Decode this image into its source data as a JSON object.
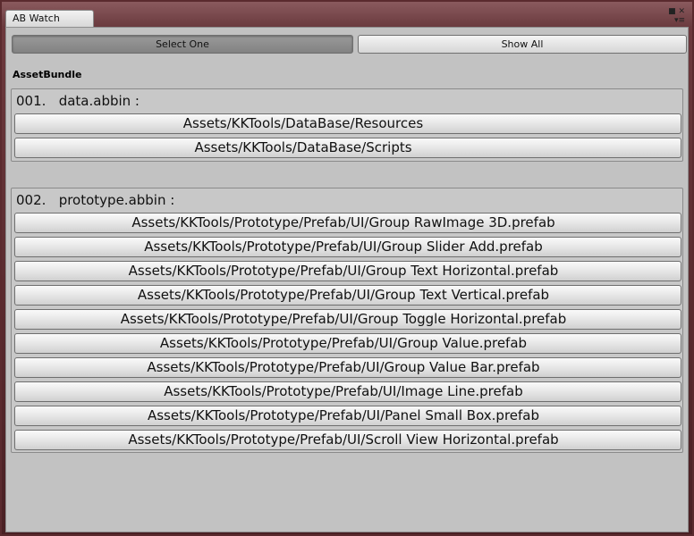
{
  "window": {
    "tab_title": "AB Watch",
    "tab_controls": "■ ✕\n▾≡"
  },
  "toolbar": {
    "select_one": "Select One",
    "show_all": "Show All"
  },
  "section": {
    "title": "AssetBundle"
  },
  "bundles": [
    {
      "header": "001.   data.abbin :",
      "items": [
        "Assets/KKTools/DataBase/Resources",
        "Assets/KKTools/DataBase/Scripts"
      ]
    },
    {
      "header": "002.   prototype.abbin :",
      "items": [
        "Assets/KKTools/Prototype/Prefab/UI/Group RawImage 3D.prefab",
        "Assets/KKTools/Prototype/Prefab/UI/Group Slider Add.prefab",
        "Assets/KKTools/Prototype/Prefab/UI/Group Text Horizontal.prefab",
        "Assets/KKTools/Prototype/Prefab/UI/Group Text Vertical.prefab",
        "Assets/KKTools/Prototype/Prefab/UI/Group Toggle Horizontal.prefab",
        "Assets/KKTools/Prototype/Prefab/UI/Group Value.prefab",
        "Assets/KKTools/Prototype/Prefab/UI/Group Value Bar.prefab",
        "Assets/KKTools/Prototype/Prefab/UI/Image Line.prefab",
        "Assets/KKTools/Prototype/Prefab/UI/Panel Small Box.prefab",
        "Assets/KKTools/Prototype/Prefab/UI/Scroll View Horizontal.prefab"
      ]
    }
  ]
}
